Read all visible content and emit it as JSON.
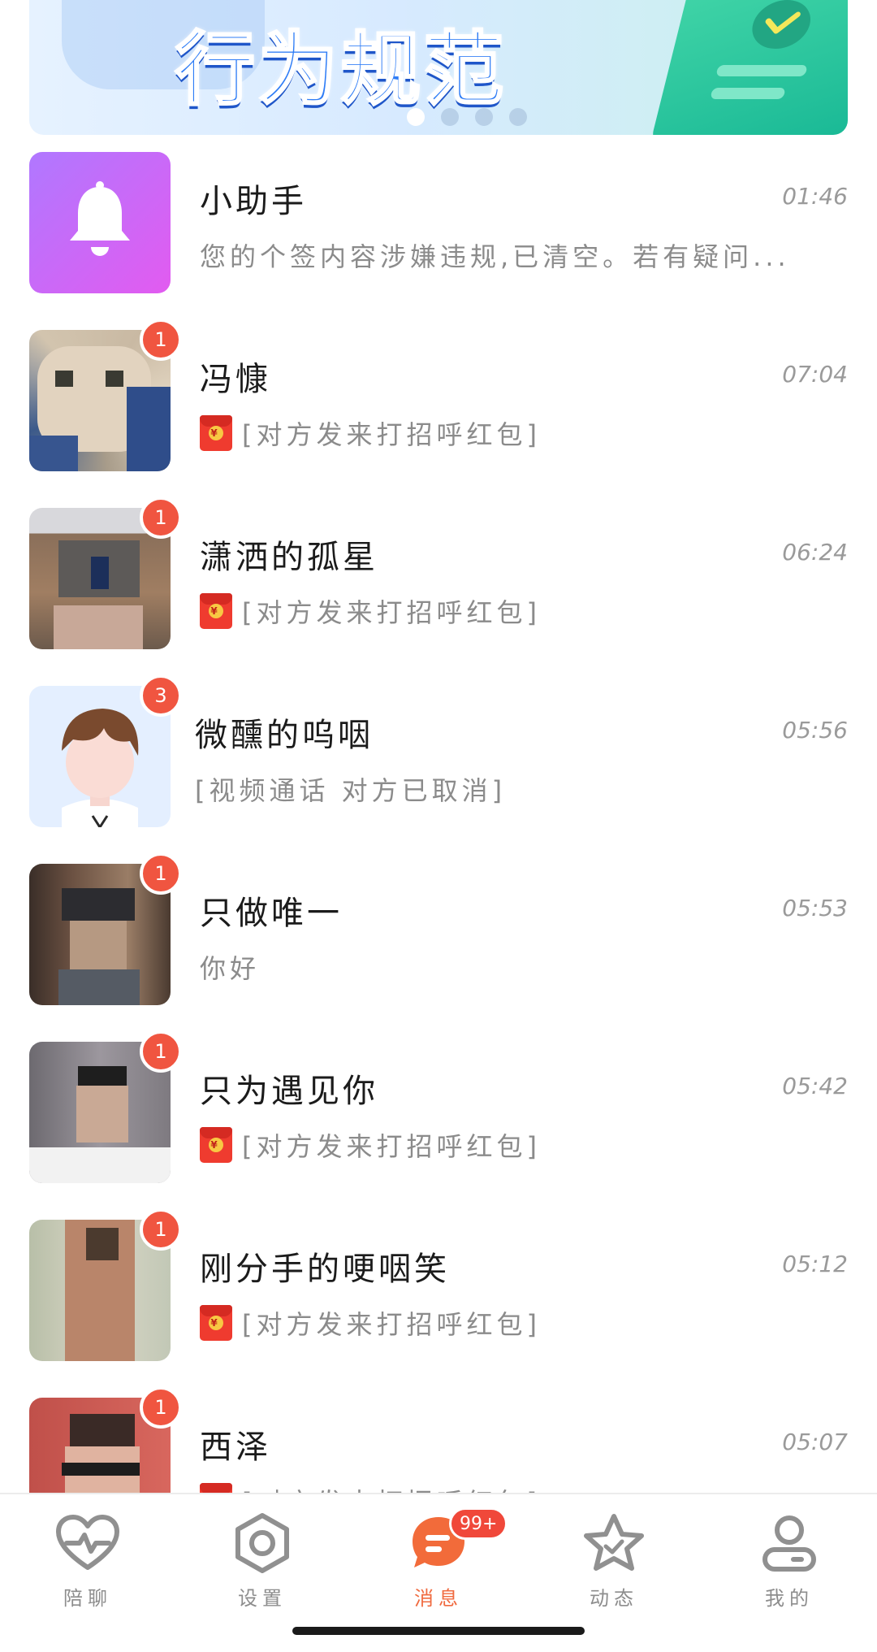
{
  "banner": {
    "title": "行为规范",
    "slide_count": 4,
    "active_slide": 0
  },
  "chats": [
    {
      "name": "小助手",
      "time": "01:46",
      "preview": "您的个签内容涉嫌违规,已清空。若有疑问...",
      "unread": "",
      "avatar": "bell-icon",
      "has_redpack": false
    },
    {
      "name": "冯慷",
      "time": "07:04",
      "preview": "[对方发来打招呼红包]",
      "unread": "1",
      "avatar": "user-photo",
      "has_redpack": true
    },
    {
      "name": "潇洒的孤星",
      "time": "06:24",
      "preview": "[对方发来打招呼红包]",
      "unread": "1",
      "avatar": "user-photo",
      "has_redpack": true
    },
    {
      "name": "微醺的呜咽",
      "time": "05:56",
      "preview": "[视频通话 对方已取消]",
      "unread": "3",
      "avatar": "cartoon-boy",
      "has_redpack": false
    },
    {
      "name": "只做唯一",
      "time": "05:53",
      "preview": "你好",
      "unread": "1",
      "avatar": "user-photo",
      "has_redpack": false
    },
    {
      "name": "只为遇见你",
      "time": "05:42",
      "preview": "[对方发来打招呼红包]",
      "unread": "1",
      "avatar": "user-photo",
      "has_redpack": true
    },
    {
      "name": "刚分手的哽咽笑",
      "time": "05:12",
      "preview": "[对方发来打招呼红包]",
      "unread": "1",
      "avatar": "user-photo",
      "has_redpack": true
    },
    {
      "name": "西泽",
      "time": "05:07",
      "preview": "[对方发来打招呼红包]",
      "unread": "1",
      "avatar": "user-photo",
      "has_redpack": true
    }
  ],
  "redpack_symbol": "¥",
  "tabbar": {
    "tabs": [
      {
        "label": "陪聊",
        "icon": "heartbeat-icon",
        "active": false
      },
      {
        "label": "设置",
        "icon": "hexagon-settings-icon",
        "active": false
      },
      {
        "label": "消息",
        "icon": "chat-bubble-icon",
        "active": true,
        "badge": "99+"
      },
      {
        "label": "动态",
        "icon": "star-icon",
        "active": false
      },
      {
        "label": "我的",
        "icon": "profile-icon",
        "active": false
      }
    ]
  },
  "colors": {
    "accent": "#f06a3f",
    "badge": "#f05540",
    "banner_title": "#2f7df6"
  }
}
